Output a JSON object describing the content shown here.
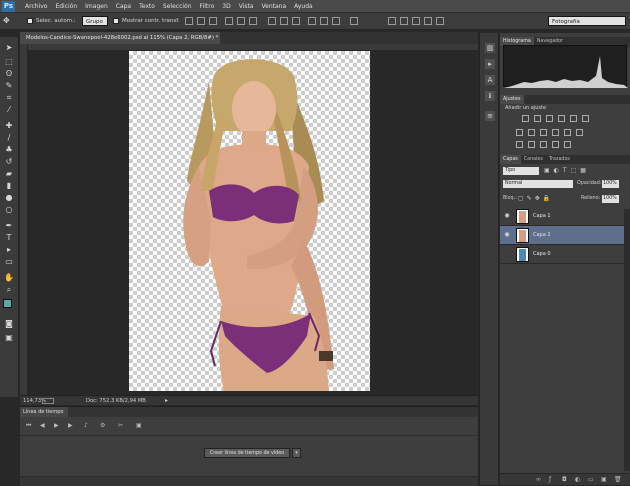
{
  "app": {
    "logo": "Ps"
  },
  "menu": [
    "Archivo",
    "Edición",
    "Imagen",
    "Capa",
    "Texto",
    "Selección",
    "Filtro",
    "3D",
    "Vista",
    "Ventana",
    "Ayuda"
  ],
  "options": {
    "auto_select_label": "Selec. autom.:",
    "auto_select_value": "Grupo",
    "show_transform_label": "Mostrar contr. transf.",
    "workspace": "Fotografía"
  },
  "document": {
    "tab_title": "Modelos-Candice-Swanepoel-428e6002.psd al 115% (Capa 2, RGB/8#) *",
    "zoom": "114,73%",
    "doc_info": "Doc: 752,3 KB/2,94 MB"
  },
  "timeline": {
    "title": "Línea de tiempo",
    "create_button": "Crear línea de tiempo de vídeo"
  },
  "right_panel": {
    "histogram_tab": "Histograma",
    "navigator_tab": "Navegador",
    "adjust_tab": "Ajustes",
    "adjust_title": "Añadir un ajuste",
    "layers_tabs": [
      "Capas",
      "Canales",
      "Trazados"
    ],
    "filter_type": "Tipo",
    "blend_mode": "Normal",
    "opacity_label": "Opacidad:",
    "opacity_value": "100%",
    "lock_label": "Bloq.:",
    "fill_label": "Relleno:",
    "fill_value": "100%",
    "layers": [
      {
        "name": "Capa 1",
        "visible": true,
        "selected": false
      },
      {
        "name": "Capa 2",
        "visible": true,
        "selected": true
      },
      {
        "name": "Capa 0",
        "visible": false,
        "selected": false
      }
    ]
  },
  "colors": {
    "foreground": "#5fa7a8",
    "background": "#ffffff",
    "bikini": "#7a2f78",
    "selected_layer": "#5e6f8e"
  }
}
